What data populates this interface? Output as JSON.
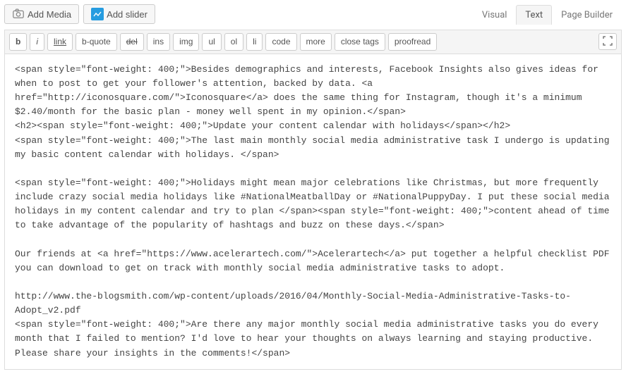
{
  "toolbar": {
    "add_media_label": "Add Media",
    "add_slider_label": "Add slider"
  },
  "tabs": {
    "visual": "Visual",
    "text": "Text",
    "page_builder": "Page Builder",
    "active": "text"
  },
  "quicktags": {
    "b": "b",
    "i": "i",
    "link": "link",
    "bquote": "b-quote",
    "del": "del",
    "ins": "ins",
    "img": "img",
    "ul": "ul",
    "ol": "ol",
    "li": "li",
    "code": "code",
    "more": "more",
    "close_tags": "close tags",
    "proofread": "proofread"
  },
  "content": "<span style=\"font-weight: 400;\">Besides demographics and interests, Facebook Insights also gives ideas for when to post to get your follower's attention, backed by data. <a href=\"http://iconosquare.com/\">Iconosquare</a> does the same thing for Instagram, though it's a minimum $2.40/month for the basic plan - money well spent in my opinion.</span>\n<h2><span style=\"font-weight: 400;\">Update your content calendar with holidays</span></h2>\n<span style=\"font-weight: 400;\">The last main monthly social media administrative task I undergo is updating my basic content calendar with holidays. </span>\n\n<span style=\"font-weight: 400;\">Holidays might mean major celebrations like Christmas, but more frequently include crazy social media holidays like #NationalMeatballDay or #NationalPuppyDay. I put these social media holidays in my content calendar and try to plan </span><span style=\"font-weight: 400;\">content ahead of time to take advantage of the popularity of hashtags and buzz on these days.</span>\n\nOur friends at <a href=\"https://www.acelerartech.com/\">Acelerartech</a> put together a helpful checklist PDF you can download to get on track with monthly social media administrative tasks to adopt.\n\nhttp://www.the-blogsmith.com/wp-content/uploads/2016/04/Monthly-Social-Media-Administrative-Tasks-to-Adopt_v2.pdf\n<span style=\"font-weight: 400;\">Are there any major monthly social media administrative tasks you do every month that I failed to mention? I'd love to hear your thoughts on always learning and staying productive. Please share your insights in the comments!</span>"
}
